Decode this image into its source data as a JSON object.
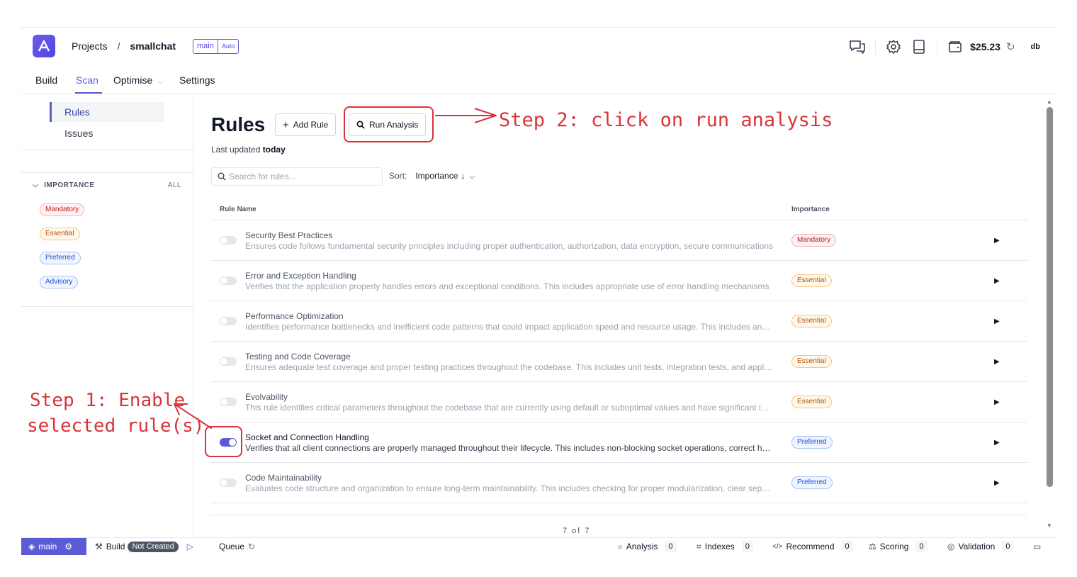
{
  "header": {
    "breadcrumb": {
      "projects": "Projects",
      "separator": "/",
      "project": "smallchat"
    },
    "branch_chip": {
      "branch": "main",
      "mode": "Auto"
    },
    "credit": "$25.23",
    "avatar": "db",
    "icons": [
      "chat-icon",
      "gear-icon",
      "book-icon",
      "wallet-icon",
      "refresh-icon"
    ]
  },
  "tabs": [
    {
      "label": "Build"
    },
    {
      "label": "Scan"
    },
    {
      "label": "Optimise"
    },
    {
      "label": "Settings"
    }
  ],
  "sidebar": {
    "nav": [
      {
        "label": "Rules"
      },
      {
        "label": "Issues"
      }
    ],
    "filter": {
      "heading": "IMPORTANCE",
      "all": "ALL",
      "chips": [
        "Mandatory",
        "Essential",
        "Preferred",
        "Advisory"
      ]
    }
  },
  "main": {
    "title": "Rules",
    "add_rule": "Add Rule",
    "run_analysis": "Run Analysis",
    "updated_prefix": "Last updated",
    "updated_value": "today",
    "search_placeholder": "Search for rules...",
    "sort_label": "Sort:",
    "sort_value": "Importance",
    "sort_arrow": "↓",
    "columns": {
      "name": "Rule Name",
      "importance": "Importance"
    },
    "rows": [
      {
        "name": "Security Best Practices",
        "desc": "Ensures code follows fundamental security principles including proper authentication, authorization, data encryption, secure communications",
        "importance": "Mandatory",
        "enabled": false
      },
      {
        "name": "Error and Exception Handling",
        "desc": "Verifies that the application properly handles errors and exceptional conditions. This includes appropriate use of error handling mechanisms",
        "importance": "Essential",
        "enabled": false
      },
      {
        "name": "Performance Optimization",
        "desc": "Identifies performance bottlenecks and inefficient code patterns that could impact application speed and resource usage. This includes analysis",
        "importance": "Essential",
        "enabled": false
      },
      {
        "name": "Testing and Code Coverage",
        "desc": "Ensures adequate test coverage and proper testing practices throughout the codebase. This includes unit tests, integration tests, and application",
        "importance": "Essential",
        "enabled": false
      },
      {
        "name": "Evolvability",
        "desc": "This rule identifies critical parameters throughout the codebase that are currently using default or suboptimal values and have significant impact",
        "importance": "Essential",
        "enabled": false
      },
      {
        "name": "Socket and Connection Handling",
        "desc": "Verifies that all client connections are properly managed throughout their lifecycle. This includes non-blocking socket operations, correct handling",
        "importance": "Preferred",
        "enabled": true
      },
      {
        "name": "Code Maintainability",
        "desc": "Evaluates code structure and organization to ensure long-term maintainability. This includes checking for proper modularization, clear separation",
        "importance": "Preferred",
        "enabled": false
      }
    ],
    "pagination": "7 of 7"
  },
  "statusbar": {
    "branch": "main",
    "build_label": "Build",
    "build_status": "Not Created",
    "queue": "Queue",
    "items": [
      {
        "label": "Analysis",
        "count": "0"
      },
      {
        "label": "Indexes",
        "count": "0"
      },
      {
        "label": "Recommend",
        "count": "0"
      },
      {
        "label": "Scoring",
        "count": "0"
      },
      {
        "label": "Validation",
        "count": "0"
      }
    ]
  },
  "annotations": {
    "step2": "Step 2: click on run analysis",
    "step1_line1": "Step 1: Enable",
    "step1_line2": "selected rule(s)"
  },
  "colors": {
    "accent": "#5b5bd6",
    "annotation": "#d8343a",
    "mandatory": "#b91c1c",
    "essential": "#b45309",
    "preferred": "#1d4ed8"
  }
}
